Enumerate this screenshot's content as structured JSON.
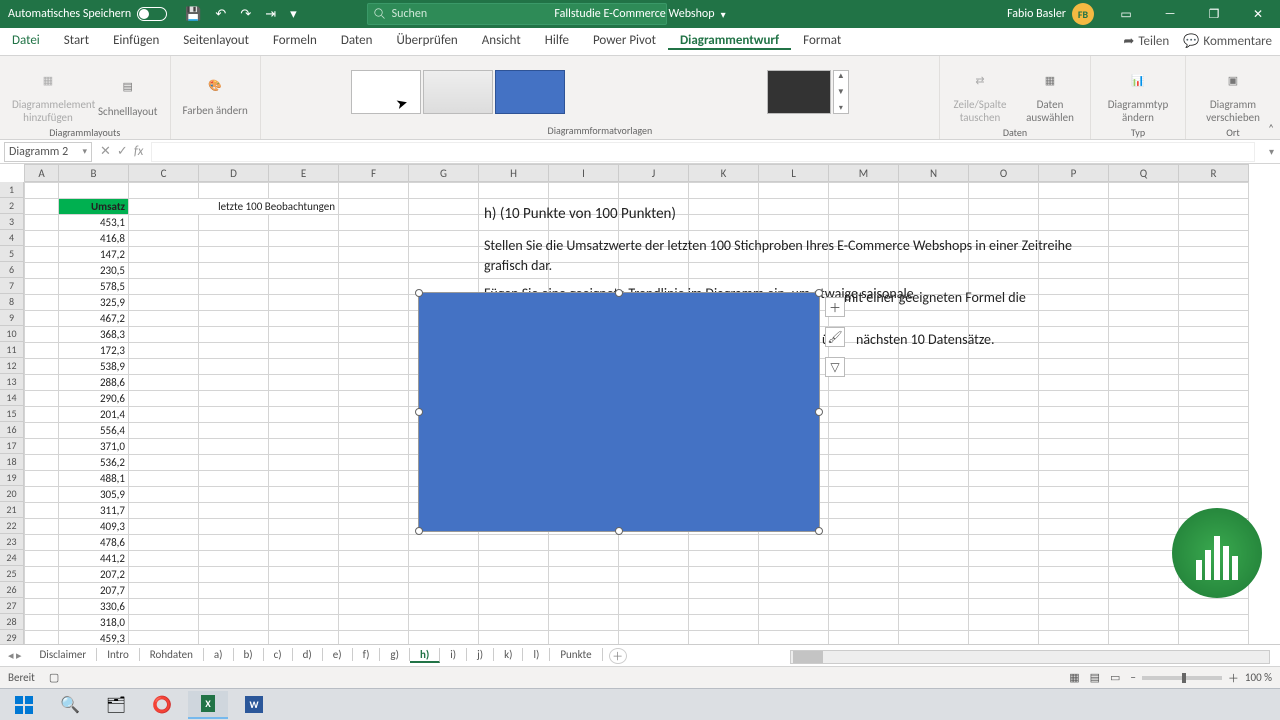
{
  "titlebar": {
    "autosave": "Automatisches Speichern",
    "doc_title": "Fallstudie E-Commerce Webshop",
    "search_placeholder": "Suchen",
    "user_name": "Fabio Basler",
    "user_initials": "FB"
  },
  "ribbon_tabs": [
    "Datei",
    "Start",
    "Einfügen",
    "Seitenlayout",
    "Formeln",
    "Daten",
    "Überprüfen",
    "Ansicht",
    "Hilfe",
    "Power Pivot",
    "Diagrammentwurf",
    "Format"
  ],
  "ribbon_active": "Diagrammentwurf",
  "ribbon_share": "Teilen",
  "ribbon_comments": "Kommentare",
  "ribbon_groups": {
    "layouts": {
      "add_element": "Diagrammelement hinzufügen",
      "quick_layout": "Schnelllayout",
      "label": "Diagrammlayouts"
    },
    "colors": {
      "change_colors": "Farben ändern"
    },
    "styles_label": "Diagrammformatvorlagen",
    "data": {
      "switch": "Zeile/Spalte tauschen",
      "select": "Daten auswählen",
      "label": "Daten"
    },
    "type": {
      "change_type": "Diagrammtyp ändern",
      "label": "Typ"
    },
    "loc": {
      "move": "Diagramm verschieben",
      "label": "Ort"
    }
  },
  "namebox": "Diagramm 2",
  "columns": [
    "A",
    "B",
    "C",
    "D",
    "E",
    "F",
    "G",
    "H",
    "I",
    "J",
    "K",
    "L",
    "M",
    "N",
    "O",
    "P",
    "Q",
    "R"
  ],
  "row_count": 29,
  "cell_b2": "Umsatz",
  "cell_c2": "letzte 100 Beobachtungen",
  "data_b": [
    "453,1",
    "416,8",
    "147,2",
    "230,5",
    "578,5",
    "325,9",
    "467,2",
    "368,3",
    "172,3",
    "538,9",
    "288,6",
    "290,6",
    "201,4",
    "556,4",
    "371,0",
    "536,2",
    "488,1",
    "305,9",
    "311,7",
    "409,3",
    "478,6",
    "441,2",
    "207,2",
    "207,7",
    "330,6",
    "318,0",
    "459,3"
  ],
  "text_h_title": "h) (10 Punkte von 100 Punkten)",
  "text_h_body1": "Stellen Sie die Umsatzwerte der letzten 100 Stichproben Ihres E-Commerce Webshops in einer Zeitreihe grafisch dar.",
  "text_h_body2": "Fügen Sie eine geeignete Trendlinie im Diagramm ein, um etwaige saisonale",
  "text_h_body2b": "mit einer geeigneten Formel die",
  "text_h_body3": "nächsten 10 Datensätze.",
  "text_h_frag": "ür",
  "sheet_tabs": [
    "Disclaimer",
    "Intro",
    "Rohdaten",
    "a)",
    "b)",
    "c)",
    "d)",
    "e)",
    "f)",
    "g)",
    "h)",
    "i)",
    "j)",
    "k)",
    "l)",
    "Punkte"
  ],
  "sheet_active": "h)",
  "status_ready": "Bereit",
  "zoom": "100 %"
}
